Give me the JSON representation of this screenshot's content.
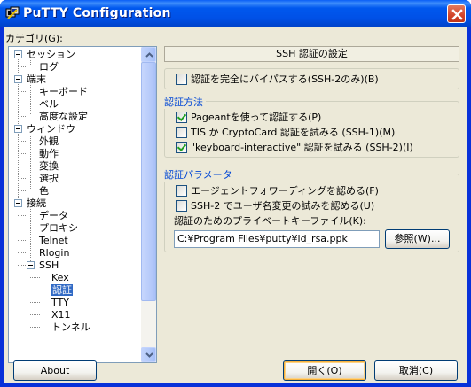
{
  "window": {
    "title": "PuTTY Configuration",
    "icon": "putty-icon"
  },
  "category_label": "カテゴリ(G):",
  "tree": [
    {
      "label": "セッション",
      "level": 0,
      "expanded": true
    },
    {
      "label": "ログ",
      "level": 1
    },
    {
      "label": "端末",
      "level": 0,
      "expanded": true
    },
    {
      "label": "キーボード",
      "level": 1
    },
    {
      "label": "ベル",
      "level": 1
    },
    {
      "label": "高度な設定",
      "level": 1
    },
    {
      "label": "ウィンドウ",
      "level": 0,
      "expanded": true
    },
    {
      "label": "外観",
      "level": 1
    },
    {
      "label": "動作",
      "level": 1
    },
    {
      "label": "変換",
      "level": 1
    },
    {
      "label": "選択",
      "level": 1
    },
    {
      "label": "色",
      "level": 1
    },
    {
      "label": "接続",
      "level": 0,
      "expanded": true
    },
    {
      "label": "データ",
      "level": 1
    },
    {
      "label": "プロキシ",
      "level": 1
    },
    {
      "label": "Telnet",
      "level": 1
    },
    {
      "label": "Rlogin",
      "level": 1
    },
    {
      "label": "SSH",
      "level": 1,
      "expanded": true
    },
    {
      "label": "Kex",
      "level": 2
    },
    {
      "label": "認証",
      "level": 2,
      "selected": true
    },
    {
      "label": "TTY",
      "level": 2
    },
    {
      "label": "X11",
      "level": 2
    },
    {
      "label": "トンネル",
      "level": 2
    }
  ],
  "panel": {
    "header": "SSH 認証の設定",
    "bypass": {
      "label": "認証を完全にバイパスする(SSH-2のみ)(B)",
      "checked": false
    },
    "methods": {
      "title": "認証方法",
      "options": [
        {
          "label": "Pageantを使って認証する(P)",
          "checked": true
        },
        {
          "label": "TIS か CryptoCard 認証を試みる (SSH-1)(M)",
          "checked": false
        },
        {
          "label": "\"keyboard-interactive\" 認証を試みる (SSH-2)(I)",
          "checked": true
        }
      ]
    },
    "params": {
      "title": "認証パラメータ",
      "options": [
        {
          "label": "エージェントフォワーディングを認める(F)",
          "checked": false
        },
        {
          "label": "SSH-2 でユーザ名変更の試みを認める(U)",
          "checked": false
        }
      ],
      "keyfile_label": "認証のためのプライベートキーファイル(K):",
      "keyfile_value": "C:¥Program Files¥putty¥id_rsa.ppk",
      "browse_label": "参照(W)..."
    }
  },
  "buttons": {
    "about": "About",
    "open": "開く(O)",
    "cancel": "取消(C)"
  },
  "colors": {
    "accent": "#316ac5",
    "group_title": "#0046d5",
    "titlebar": "#0058ee",
    "close": "#d2442a"
  }
}
